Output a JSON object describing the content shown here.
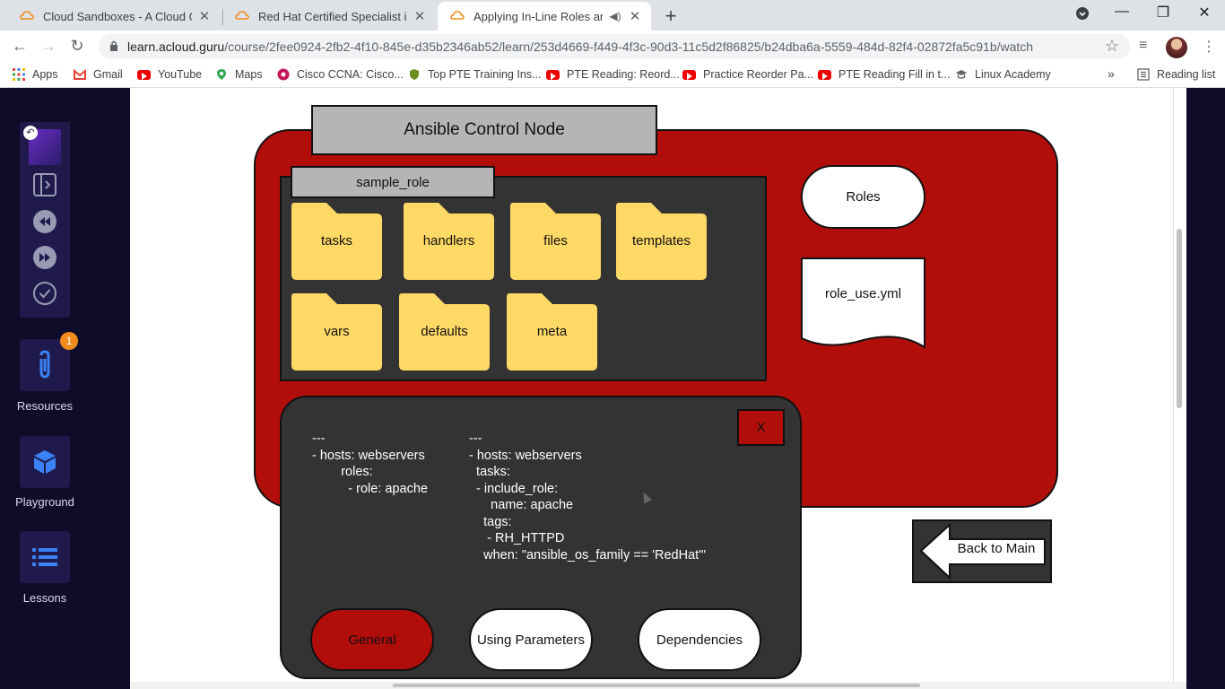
{
  "browser": {
    "tabs": [
      {
        "title": "Cloud Sandboxes - A Cloud Guru"
      },
      {
        "title": "Red Hat Certified Specialist in An"
      },
      {
        "title": "Applying In-Line Roles and R"
      }
    ],
    "url_host": "learn.acloud.guru",
    "url_path": "/course/2fee0924-2fb2-4f10-845e-d35b2346ab52/learn/253d4669-f449-4f3c-90d3-11c5d2f86825/b24dba6a-5559-484d-82f4-02872fa5c91b/watch",
    "bookmarks": [
      "Apps",
      "Gmail",
      "YouTube",
      "Maps",
      "Cisco CCNA: Cisco...",
      "Top PTE Training Ins...",
      "PTE Reading: Reord...",
      "Practice Reorder Pa...",
      "PTE Reading Fill in t...",
      "Linux Academy"
    ],
    "overflow": "»",
    "reading_list": "Reading list"
  },
  "sidebar": {
    "resources_label": "Resources",
    "resources_badge": "1",
    "playground_label": "Playground",
    "lessons_label": "Lessons"
  },
  "slide": {
    "control_node": "Ansible Control Node",
    "role_name": "sample_role",
    "folders": [
      "tasks",
      "handlers",
      "files",
      "templates",
      "vars",
      "defaults",
      "meta"
    ],
    "roles_label": "Roles",
    "file_label": "role_use.yml",
    "close_label": "X",
    "code_left": "---\n- hosts: webservers\n        roles:\n          - role: apache",
    "code_right": "---\n- hosts: webservers\n  tasks:\n  - include_role:\n      name: apache\n    tags:\n     - RH_HTTPD\n    when: \"ansible_os_family == 'RedHat'\"",
    "buttons": {
      "general": "General",
      "params": "Using Parameters",
      "deps": "Dependencies"
    },
    "back_label": "Back to Main",
    "colors": {
      "red": "#b10e0b",
      "folder": "#ffd966",
      "panel": "#333333"
    }
  }
}
